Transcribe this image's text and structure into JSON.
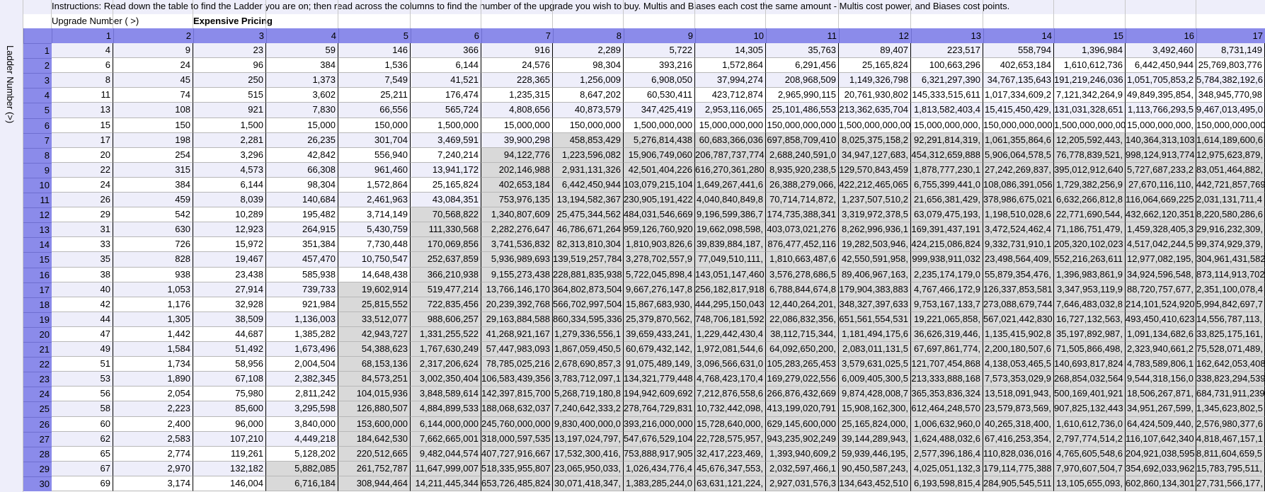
{
  "instructions": "Instructions: Read down the table to find the Ladder you are on; then read across the columns to find the number of the upgrade you wish to buy. Multis and Biases each cost the same amount - Multis cost power, and Biases cost points.",
  "upgrade_label": "Upgrade Number ( >)",
  "pricing_label": "Expensive Pricing",
  "ladder_label": "Ladder Number (>)",
  "columns": [
    "1",
    "2",
    "3",
    "4",
    "5",
    "6",
    "7",
    "8",
    "9",
    "10",
    "11",
    "12",
    "13",
    "14",
    "15",
    "16",
    "17"
  ],
  "rows": [
    {
      "n": "1",
      "c": [
        "4",
        "9",
        "23",
        "59",
        "146",
        "366",
        "916",
        "2,289",
        "5,722",
        "14,305",
        "35,763",
        "89,407",
        "223,517",
        "558,794",
        "1,396,984",
        "3,492,460",
        "8,731,149"
      ]
    },
    {
      "n": "2",
      "c": [
        "6",
        "24",
        "96",
        "384",
        "1,536",
        "6,144",
        "24,576",
        "98,304",
        "393,216",
        "1,572,864",
        "6,291,456",
        "25,165,824",
        "100,663,296",
        "402,653,184",
        "1,610,612,736",
        "6,442,450,944",
        "25,769,803,776"
      ]
    },
    {
      "n": "3",
      "c": [
        "8",
        "45",
        "250",
        "1,373",
        "7,549",
        "41,521",
        "228,365",
        "1,256,009",
        "6,908,050",
        "37,994,274",
        "208,968,509",
        "1,149,326,798",
        "6,321,297,390",
        "34,767,135,643",
        "191,219,246,036",
        "1,051,705,853,2",
        "5,784,382,192,6"
      ]
    },
    {
      "n": "4",
      "c": [
        "11",
        "74",
        "515",
        "3,602",
        "25,211",
        "176,474",
        "1,235,315",
        "8,647,202",
        "60,530,411",
        "423,712,874",
        "2,965,990,115",
        "20,761,930,802",
        "145,333,515,611",
        "1,017,334,609,2",
        "7,121,342,264,9",
        "49,849,395,854,",
        "348,945,770,98"
      ]
    },
    {
      "n": "5",
      "c": [
        "13",
        "108",
        "921",
        "7,830",
        "66,556",
        "565,724",
        "4,808,656",
        "40,873,579",
        "347,425,419",
        "2,953,116,065",
        "25,101,486,553",
        "213,362,635,704",
        "1,813,582,403,4",
        "15,415,450,429,",
        "131,031,328,651",
        "1,113,766,293,5",
        "9,467,013,495,0"
      ]
    },
    {
      "n": "6",
      "c": [
        "15",
        "150",
        "1,500",
        "15,000",
        "150,000",
        "1,500,000",
        "15,000,000",
        "150,000,000",
        "1,500,000,000",
        "15,000,000,000",
        "150,000,000,000",
        "1,500,000,000,00",
        "15,000,000,000,",
        "150,000,000,000",
        "1,500,000,000,00",
        "15,000,000,000,",
        "150,000,000,000"
      ]
    },
    {
      "n": "7",
      "c": [
        "17",
        "198",
        "2,281",
        "26,235",
        "301,704",
        "3,469,591",
        "39,900,298",
        "458,853,429",
        "5,276,814,438",
        "60,683,366,036",
        "697,858,709,410",
        "8,025,375,158,2",
        "92,291,814,319,",
        "1,061,355,864,6",
        "12,205,592,443,",
        "140,364,313,103",
        "1,614,189,600,6"
      ]
    },
    {
      "n": "8",
      "c": [
        "20",
        "254",
        "3,296",
        "42,842",
        "556,940",
        "7,240,214",
        "94,122,776",
        "1,223,596,082",
        "15,906,749,060",
        "206,787,737,774",
        "2,688,240,591,0",
        "34,947,127,683,",
        "454,312,659,888",
        "5,906,064,578,5",
        "76,778,839,521,",
        "998,124,913,774",
        "12,975,623,879,"
      ]
    },
    {
      "n": "9",
      "c": [
        "22",
        "315",
        "4,573",
        "66,308",
        "961,460",
        "13,941,172",
        "202,146,988",
        "2,931,131,326",
        "42,501,404,226",
        "616,270,361,280",
        "8,935,920,238,5",
        "129,570,843,459",
        "1,878,777,230,1",
        "27,242,269,837,",
        "395,012,912,640",
        "5,727,687,233,2",
        "83,051,464,882,"
      ]
    },
    {
      "n": "10",
      "c": [
        "24",
        "384",
        "6,144",
        "98,304",
        "1,572,864",
        "25,165,824",
        "402,653,184",
        "6,442,450,944",
        "103,079,215,104",
        "1,649,267,441,6",
        "26,388,279,066,",
        "422,212,465,065",
        "6,755,399,441,0",
        "108,086,391,056",
        "1,729,382,256,9",
        "27,670,116,110,",
        "442,721,857,769"
      ]
    },
    {
      "n": "11",
      "c": [
        "26",
        "459",
        "8,039",
        "140,684",
        "2,461,963",
        "43,084,351",
        "753,976,135",
        "13,194,582,367",
        "230,905,191,422",
        "4,040,840,849,8",
        "70,714,714,872,",
        "1,237,507,510,2",
        "21,656,381,429,",
        "378,986,675,021",
        "6,632,266,812,8",
        "116,064,669,225",
        "2,031,131,711,4"
      ]
    },
    {
      "n": "12",
      "c": [
        "29",
        "542",
        "10,289",
        "195,482",
        "3,714,149",
        "70,568,822",
        "1,340,807,609",
        "25,475,344,562",
        "484,031,546,669",
        "9,196,599,386,7",
        "174,735,388,341",
        "3,319,972,378,5",
        "63,079,475,193,",
        "1,198,510,028,6",
        "22,771,690,544,",
        "432,662,120,351",
        "8,220,580,286,6"
      ]
    },
    {
      "n": "13",
      "c": [
        "31",
        "630",
        "12,923",
        "264,915",
        "5,430,759",
        "111,330,568",
        "2,282,276,647",
        "46,786,671,264",
        "959,126,760,920",
        "19,662,098,598,",
        "403,073,021,276",
        "8,262,996,936,1",
        "169,391,437,191",
        "3,472,524,462,4",
        "71,186,751,479,",
        "1,459,328,405,3",
        "29,916,232,309,"
      ]
    },
    {
      "n": "14",
      "c": [
        "33",
        "726",
        "15,972",
        "351,384",
        "7,730,448",
        "170,069,856",
        "3,741,536,832",
        "82,313,810,304",
        "1,810,903,826,6",
        "39,839,884,187,",
        "876,477,452,116",
        "19,282,503,946,",
        "424,215,086,824",
        "9,332,731,910,1",
        "205,320,102,023",
        "4,517,042,244,5",
        "99,374,929,379,"
      ]
    },
    {
      "n": "15",
      "c": [
        "35",
        "828",
        "19,467",
        "457,470",
        "10,750,547",
        "252,637,859",
        "5,936,989,693",
        "139,519,257,784",
        "3,278,702,557,9",
        "77,049,510,111,",
        "1,810,663,487,6",
        "42,550,591,958,",
        "999,938,911,032",
        "23,498,564,409,",
        "552,216,263,611",
        "12,977,082,195,",
        "304,961,431,582"
      ]
    },
    {
      "n": "16",
      "c": [
        "38",
        "938",
        "23,438",
        "585,938",
        "14,648,438",
        "366,210,938",
        "9,155,273,438",
        "228,881,835,938",
        "5,722,045,898,4",
        "143,051,147,460",
        "3,576,278,686,5",
        "89,406,967,163,",
        "2,235,174,179,0",
        "55,879,354,476,",
        "1,396,983,861,9",
        "34,924,596,548,",
        "873,114,913,702"
      ]
    },
    {
      "n": "17",
      "c": [
        "40",
        "1,053",
        "27,914",
        "739,733",
        "19,602,914",
        "519,477,214",
        "13,766,146,170",
        "364,802,873,504",
        "9,667,276,147,8",
        "256,182,817,918",
        "6,788,844,674,8",
        "179,904,383,883",
        "4,767,466,172,9",
        "126,337,853,581",
        "3,347,953,119,9",
        "88,720,757,677,",
        "2,351,100,078,4"
      ]
    },
    {
      "n": "18",
      "c": [
        "42",
        "1,176",
        "32,928",
        "921,984",
        "25,815,552",
        "722,835,456",
        "20,239,392,768",
        "566,702,997,504",
        "15,867,683,930,",
        "444,295,150,043",
        "12,440,264,201,",
        "348,327,397,633",
        "9,753,167,133,7",
        "273,088,679,744",
        "7,646,483,032,8",
        "214,101,524,920",
        "5,994,842,697,7"
      ]
    },
    {
      "n": "19",
      "c": [
        "44",
        "1,305",
        "38,509",
        "1,136,003",
        "33,512,077",
        "988,606,257",
        "29,163,884,588",
        "860,334,595,336",
        "25,379,870,562,",
        "748,706,181,592",
        "22,086,832,356,",
        "651,561,554,531",
        "19,221,065,858,",
        "567,021,442,830",
        "16,727,132,563,",
        "493,450,410,623",
        "14,556,787,113,"
      ]
    },
    {
      "n": "20",
      "c": [
        "47",
        "1,442",
        "44,687",
        "1,385,282",
        "42,943,727",
        "1,331,255,522",
        "41,268,921,167",
        "1,279,336,556,1",
        "39,659,433,241,",
        "1,229,442,430,4",
        "38,112,715,344,",
        "1,181,494,175,6",
        "36,626,319,446,",
        "1,135,415,902,8",
        "35,197,892,987,",
        "1,091,134,682,6",
        "33,825,175,161,"
      ]
    },
    {
      "n": "21",
      "c": [
        "49",
        "1,584",
        "51,492",
        "1,673,496",
        "54,388,623",
        "1,767,630,249",
        "57,447,983,093",
        "1,867,059,450,5",
        "60,679,432,142,",
        "1,972,081,544,6",
        "64,092,650,200,",
        "2,083,011,131,5",
        "67,697,861,774,",
        "2,200,180,507,6",
        "71,505,866,498,",
        "2,323,940,661,2",
        "75,528,071,489,"
      ]
    },
    {
      "n": "22",
      "c": [
        "51",
        "1,734",
        "58,956",
        "2,004,504",
        "68,153,136",
        "2,317,206,624",
        "78,785,025,216",
        "2,678,690,857,3",
        "91,075,489,149,",
        "3,096,566,631,0",
        "105,283,265,453",
        "3,579,631,025,5",
        "121,707,454,868",
        "4,138,053,465,5",
        "140,693,817,824",
        "4,783,589,806,1",
        "162,642,053,408"
      ]
    },
    {
      "n": "23",
      "c": [
        "53",
        "1,890",
        "67,108",
        "2,382,345",
        "84,573,251",
        "3,002,350,404",
        "106,583,439,356",
        "3,783,712,097,1",
        "134,321,779,448",
        "4,768,423,170,4",
        "169,279,022,556",
        "6,009,405,300,5",
        "213,333,888,168",
        "7,573,353,029,9",
        "268,854,032,564",
        "9,544,318,156,0",
        "338,823,294,539"
      ]
    },
    {
      "n": "24",
      "c": [
        "56",
        "2,054",
        "75,980",
        "2,811,242",
        "104,015,936",
        "3,848,589,614",
        "142,397,815,700",
        "5,268,719,180,8",
        "194,942,609,692",
        "7,212,876,558,6",
        "266,876,432,669",
        "9,874,428,008,7",
        "365,353,836,324",
        "13,518,091,943,",
        "500,169,401,921",
        "18,506,267,871,",
        "684,731,911,239"
      ]
    },
    {
      "n": "25",
      "c": [
        "58",
        "2,223",
        "85,600",
        "3,295,598",
        "126,880,507",
        "4,884,899,533",
        "188,068,632,037",
        "7,240,642,333,2",
        "278,764,729,831",
        "10,732,442,098,",
        "413,199,020,791",
        "15,908,162,300,",
        "612,464,248,570",
        "23,579,873,569,",
        "907,825,132,443",
        "34,951,267,599,",
        "1,345,623,802,5"
      ]
    },
    {
      "n": "26",
      "c": [
        "60",
        "2,400",
        "96,000",
        "3,840,000",
        "153,600,000",
        "6,144,000,000",
        "245,760,000,000",
        "9,830,400,000,0",
        "393,216,000,000",
        "15,728,640,000,",
        "629,145,600,000",
        "25,165,824,000,",
        "1,006,632,960,0",
        "40,265,318,400,",
        "1,610,612,736,0",
        "64,424,509,440,",
        "2,576,980,377,6"
      ]
    },
    {
      "n": "27",
      "c": [
        "62",
        "2,583",
        "107,210",
        "4,449,218",
        "184,642,530",
        "7,662,665,001",
        "318,000,597,535",
        "13,197,024,797,",
        "547,676,529,104",
        "22,728,575,957,",
        "943,235,902,249",
        "39,144,289,943,",
        "1,624,488,032,6",
        "67,416,253,354,",
        "2,797,774,514,2",
        "116,107,642,340",
        "4,818,467,157,1"
      ]
    },
    {
      "n": "28",
      "c": [
        "65",
        "2,774",
        "119,261",
        "5,128,202",
        "220,512,665",
        "9,482,044,574",
        "407,727,916,667",
        "17,532,300,416,",
        "753,888,917,905",
        "32,417,223,469,",
        "1,393,940,609,2",
        "59,939,446,195,",
        "2,577,396,186,4",
        "110,828,036,016",
        "4,765,605,548,6",
        "204,921,038,595",
        "8,811,604,659,5"
      ]
    },
    {
      "n": "29",
      "c": [
        "67",
        "2,970",
        "132,182",
        "5,882,085",
        "261,752,787",
        "11,647,999,007",
        "518,335,955,807",
        "23,065,950,033,",
        "1,026,434,776,4",
        "45,676,347,553,",
        "2,032,597,466,1",
        "90,450,587,243,",
        "4,025,051,132,3",
        "179,114,775,388",
        "7,970,607,504,7",
        "354,692,033,962",
        "15,783,795,511,"
      ]
    },
    {
      "n": "30",
      "c": [
        "69",
        "3,174",
        "146,004",
        "6,716,184",
        "308,944,464",
        "14,211,445,344",
        "653,726,485,824",
        "30,071,418,347,",
        "1,383,285,244,0",
        "63,631,121,224,",
        "2,927,031,576,3",
        "134,643,452,510",
        "6,193,598,815,4",
        "284,905,545,511",
        "13,105,655,093,",
        "602,860,134,301",
        "27,731,566,177,"
      ]
    }
  ]
}
